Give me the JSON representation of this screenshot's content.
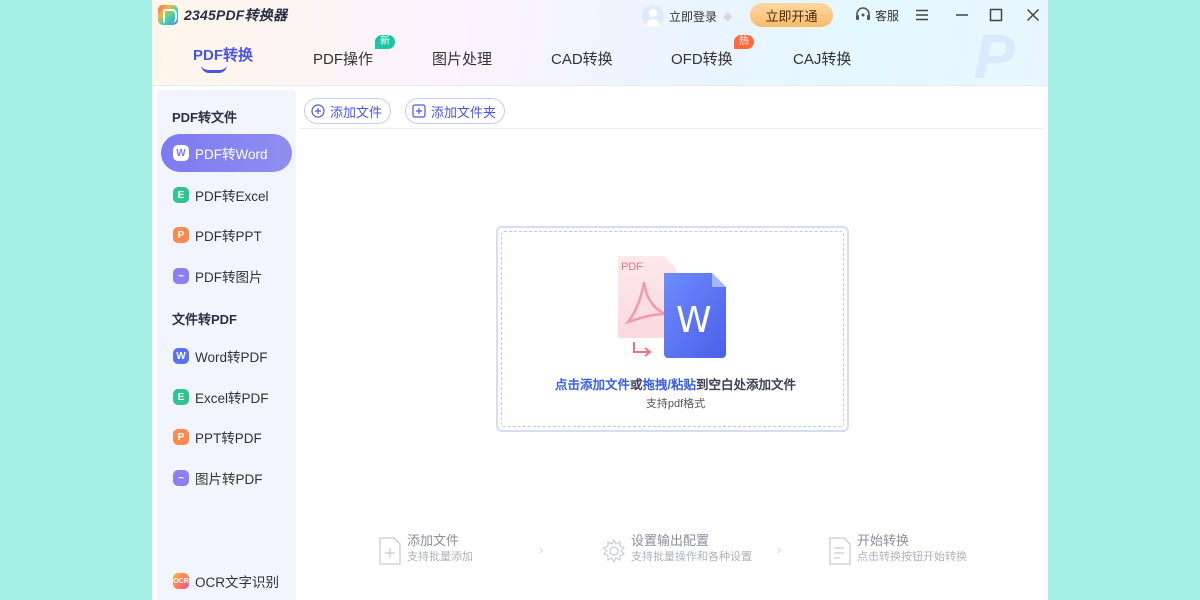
{
  "app": {
    "title": "2345PDF转换器"
  },
  "header": {
    "login_label": "立即登录",
    "vip_button": "立即开通",
    "service_label": "客服"
  },
  "tabs": [
    {
      "label": "PDF转换",
      "active": true
    },
    {
      "label": "PDF操作",
      "badge": "新"
    },
    {
      "label": "图片处理"
    },
    {
      "label": "CAD转换"
    },
    {
      "label": "OFD转换",
      "badge": "热"
    },
    {
      "label": "CAJ转换"
    }
  ],
  "sidebar": {
    "section1_title": "PDF转文件",
    "section2_title": "文件转PDF",
    "items": [
      {
        "label": "PDF转Word",
        "icon": "word-icon",
        "active": true
      },
      {
        "label": "PDF转Excel",
        "icon": "excel-icon"
      },
      {
        "label": "PDF转PPT",
        "icon": "ppt-icon"
      },
      {
        "label": "PDF转图片",
        "icon": "image-icon"
      },
      {
        "label": "Word转PDF",
        "icon": "word-icon"
      },
      {
        "label": "Excel转PDF",
        "icon": "excel-icon"
      },
      {
        "label": "PPT转PDF",
        "icon": "ppt-icon"
      },
      {
        "label": "图片转PDF",
        "icon": "image-icon"
      }
    ],
    "ocr_label": "OCR文字识别"
  },
  "toolbar": {
    "add_file": "添加文件",
    "add_folder": "添加文件夹"
  },
  "dropzone": {
    "pdf_tag": "PDF",
    "word_glyph": "W",
    "click_add": "点击添加文件",
    "or": "或",
    "drag_paste": "拖拽/粘贴",
    "to_blank": "到空白处添加文件",
    "support": "支持pdf格式"
  },
  "steps": [
    {
      "title": "添加文件",
      "desc": "支持批量添加"
    },
    {
      "title": "设置输出配置",
      "desc": "支持批量操作和各种设置"
    },
    {
      "title": "开始转换",
      "desc": "点击转换按钮开始转换"
    }
  ],
  "colors": {
    "accent": "#4a56e2",
    "sidebar_active": "#7e7af3",
    "page_bg": "#a5f0e4",
    "vip": "#f7bb6a",
    "badge_new": "#17c7a1",
    "badge_hot": "#ff6b3d"
  }
}
